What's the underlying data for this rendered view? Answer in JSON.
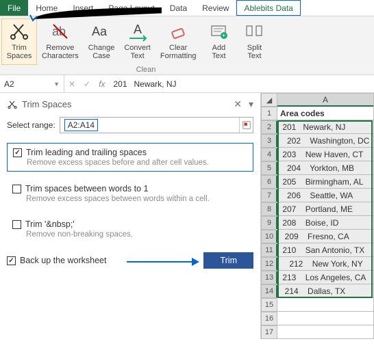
{
  "tabs": {
    "file": "File",
    "home": "Home",
    "insert": "Insert",
    "pagelayout": "Page Layout",
    "data": "Data",
    "review": "Review",
    "ablebits": "Ablebits Data"
  },
  "ribbon": {
    "trim": "Trim\nSpaces",
    "remove": "Remove\nCharacters",
    "change": "Change\nCase",
    "convert": "Convert\nText",
    "clear": "Clear\nFormatting",
    "add": "Add\nText",
    "split": "Split\nText",
    "groupLabel": "Clean"
  },
  "namebox": "A2",
  "formula": "201   Newark, NJ",
  "pane": {
    "title": "Trim Spaces",
    "selectLabel": "Select range:",
    "rangeValue": "A2:A14",
    "opt1": {
      "label": "Trim leading and trailing spaces",
      "desc": "Remove excess spaces before and after cell values."
    },
    "opt2": {
      "label": "Trim spaces between words to 1",
      "desc": "Remove excess spaces between words within a cell."
    },
    "opt3": {
      "label": "Trim '&nbsp;'",
      "desc": "Remove non-breaking spaces."
    },
    "backup": "Back up the worksheet",
    "trimBtn": "Trim"
  },
  "grid": {
    "colLabel": "A",
    "header": "Area codes",
    "rows": [
      " 201   Newark, NJ",
      "   202    Washington, DC",
      " 203    New Haven, CT",
      "   204    Yorkton, MB",
      " 205    Birmingham, AL",
      "   206    Seattle, WA",
      " 207    Portland, ME",
      " 208    Boise, ID",
      "  209    Fresno, CA",
      " 210    San Antonio, TX",
      "    212    New York, NY",
      " 213    Los Angeles, CA",
      "  214    Dallas, TX"
    ]
  }
}
